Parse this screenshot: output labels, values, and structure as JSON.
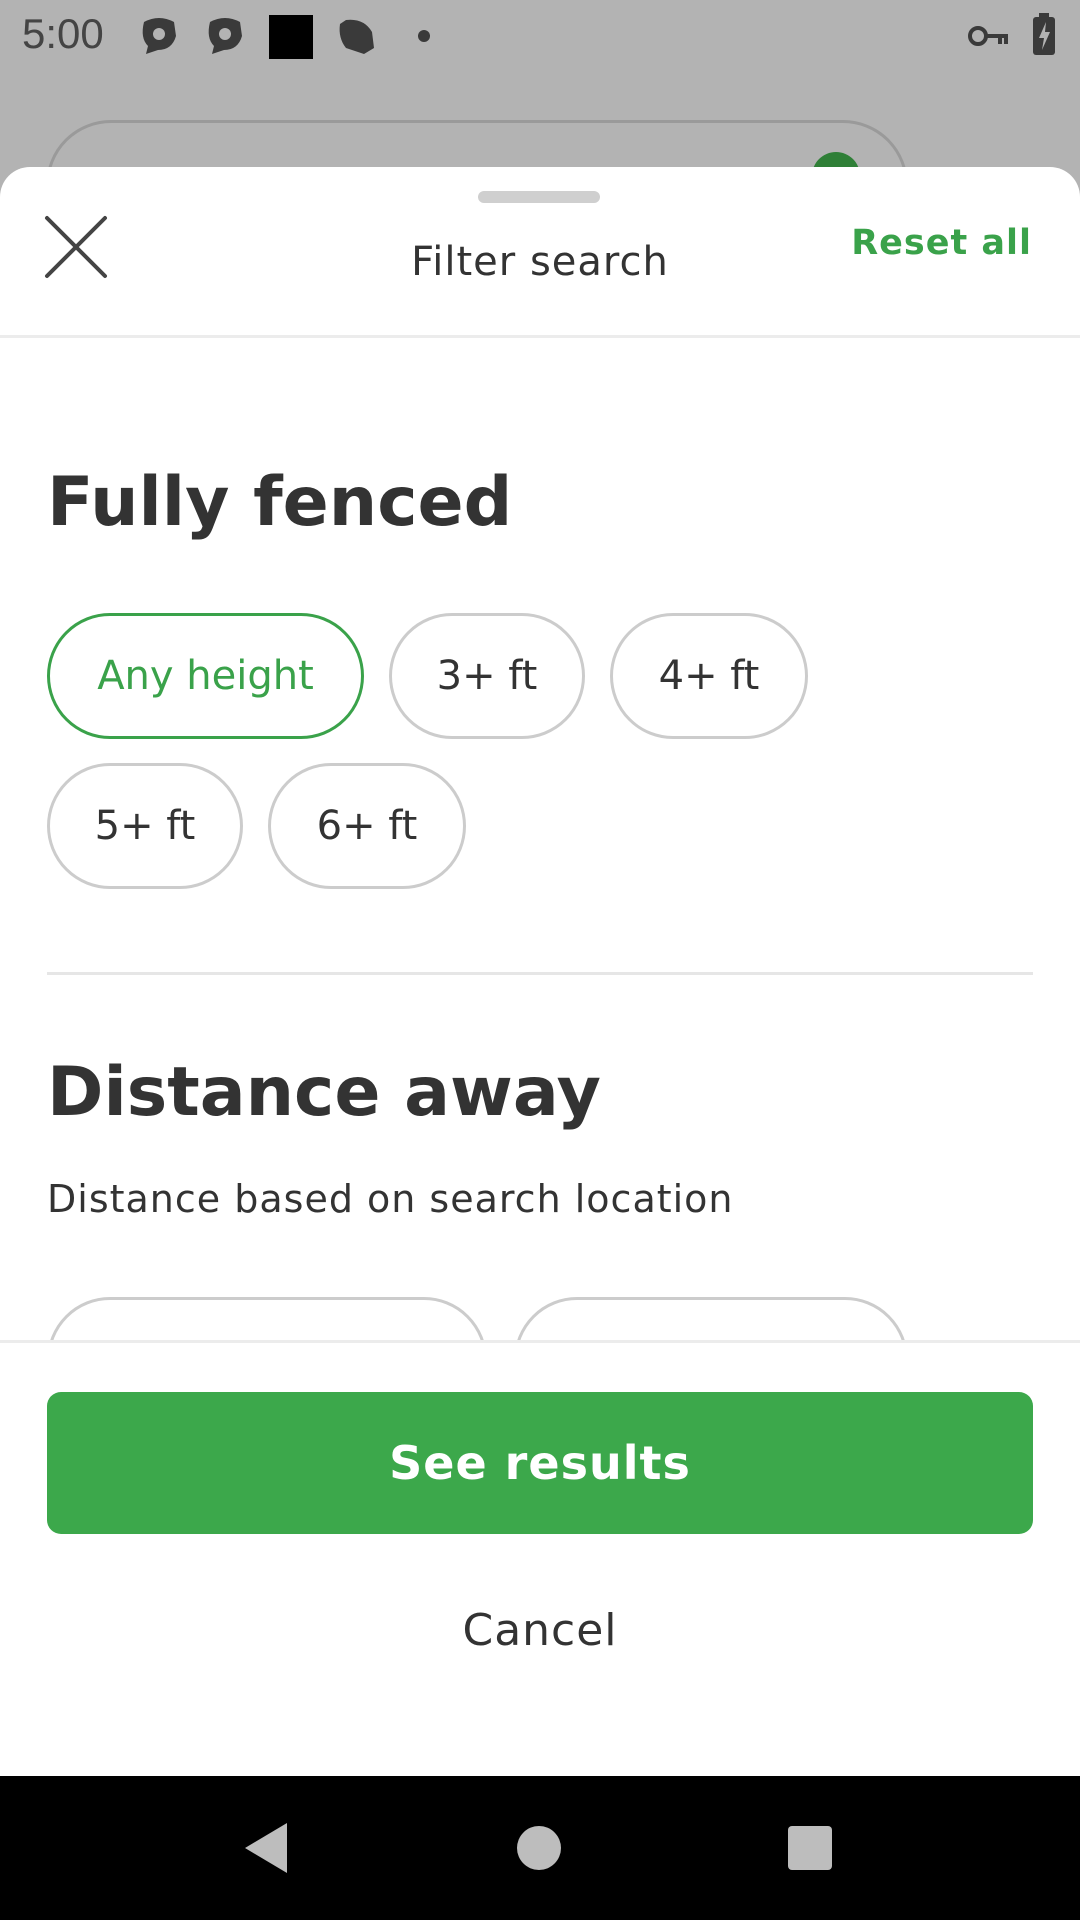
{
  "status_bar": {
    "time": "5:00"
  },
  "sheet": {
    "title": "Filter search",
    "reset_label": "Reset all"
  },
  "fully_fenced": {
    "title": "Fully fenced",
    "options": [
      "Any height",
      "3+ ft",
      "4+ ft",
      "5+ ft",
      "6+ ft"
    ],
    "selected": "Any height"
  },
  "distance": {
    "title": "Distance away",
    "subtitle": "Distance based on search location"
  },
  "footer": {
    "primary_label": "See results",
    "cancel_label": "Cancel"
  },
  "colors": {
    "accent": "#3aa24a",
    "button_bg": "#3ca84b",
    "text": "#333333",
    "overlay": "#b3b3b3"
  },
  "icons": {
    "close": "close-icon",
    "back": "back-triangle-icon",
    "home": "home-circle-icon",
    "recents": "recents-square-icon"
  }
}
